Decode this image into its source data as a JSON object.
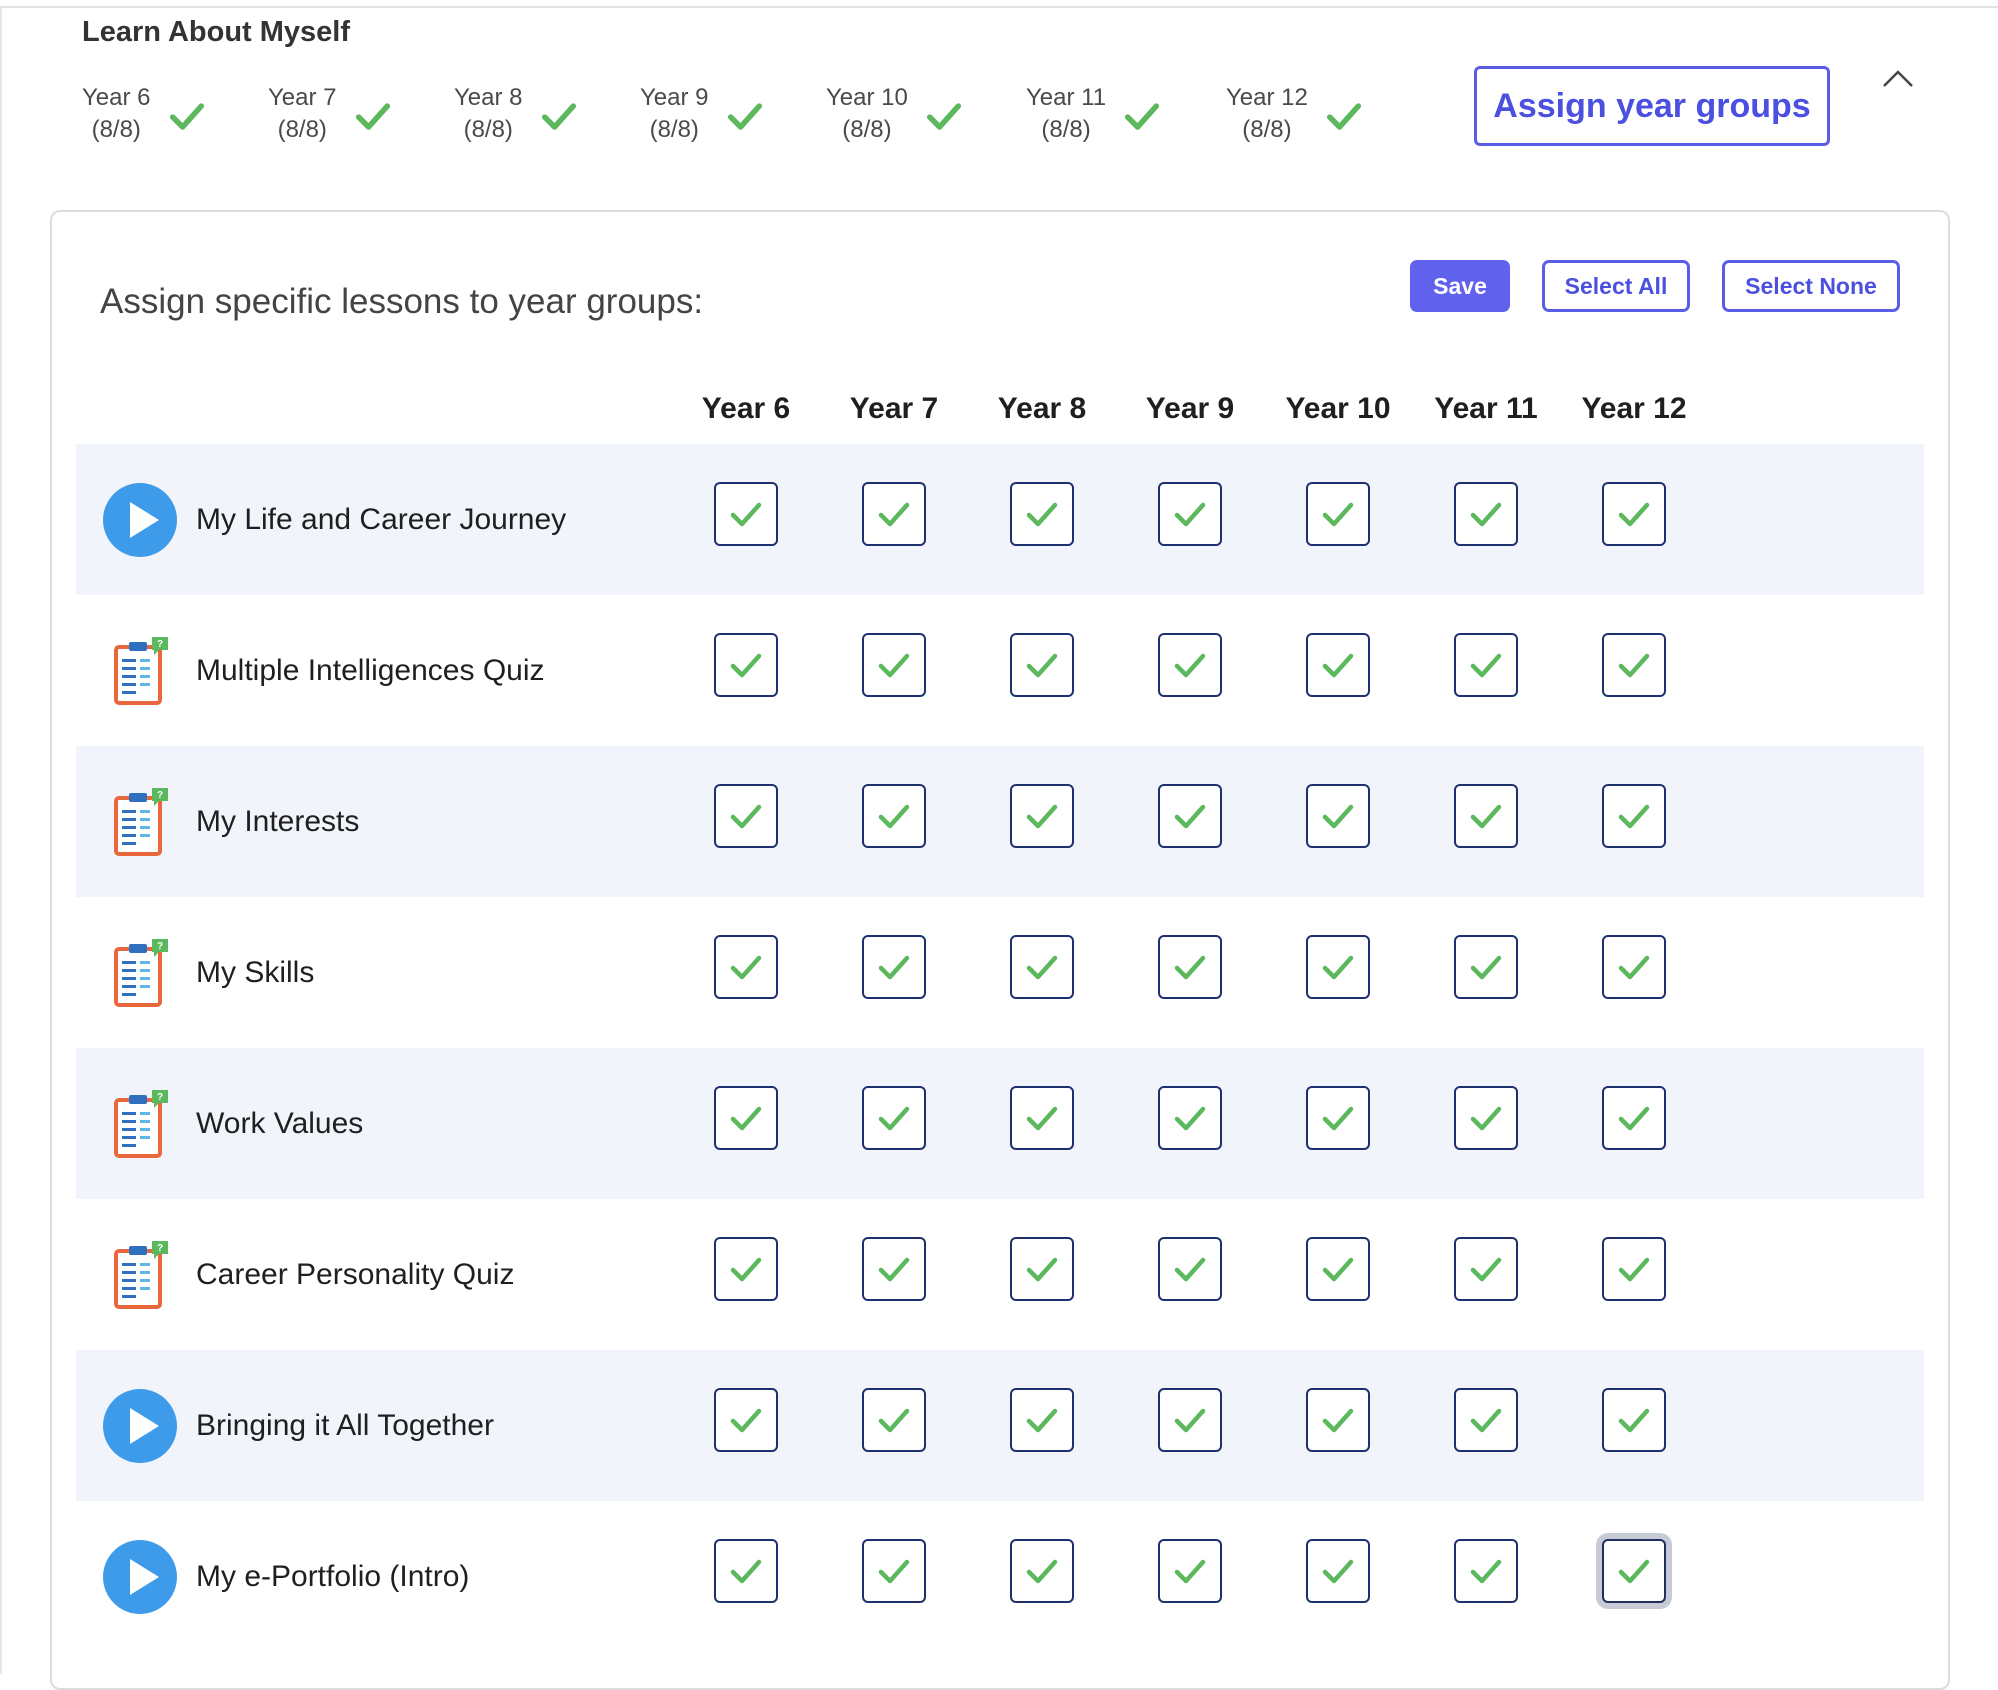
{
  "section": {
    "title": "Learn About Myself",
    "assign_button": "Assign year groups",
    "summary": [
      {
        "year": "Year 6",
        "count": "(8/8)"
      },
      {
        "year": "Year 7",
        "count": "(8/8)"
      },
      {
        "year": "Year 8",
        "count": "(8/8)"
      },
      {
        "year": "Year 9",
        "count": "(8/8)"
      },
      {
        "year": "Year 10",
        "count": "(8/8)"
      },
      {
        "year": "Year 11",
        "count": "(8/8)"
      },
      {
        "year": "Year 12",
        "count": "(8/8)"
      }
    ]
  },
  "panel": {
    "title": "Assign specific lessons to year groups:",
    "save_label": "Save",
    "select_all_label": "Select All",
    "select_none_label": "Select None",
    "columns": [
      "Year 6",
      "Year 7",
      "Year 8",
      "Year 9",
      "Year 10",
      "Year 11",
      "Year 12"
    ],
    "lessons": [
      {
        "name": "My Life and Career Journey",
        "icon": "play-icon",
        "checked": [
          true,
          true,
          true,
          true,
          true,
          true,
          true
        ]
      },
      {
        "name": "Multiple Intelligences Quiz",
        "icon": "clipboard-quiz-icon",
        "checked": [
          true,
          true,
          true,
          true,
          true,
          true,
          true
        ]
      },
      {
        "name": "My Interests",
        "icon": "clipboard-quiz-icon",
        "checked": [
          true,
          true,
          true,
          true,
          true,
          true,
          true
        ]
      },
      {
        "name": "My Skills",
        "icon": "clipboard-quiz-icon",
        "checked": [
          true,
          true,
          true,
          true,
          true,
          true,
          true
        ]
      },
      {
        "name": "Work Values",
        "icon": "clipboard-quiz-icon",
        "checked": [
          true,
          true,
          true,
          true,
          true,
          true,
          true
        ]
      },
      {
        "name": "Career Personality Quiz",
        "icon": "clipboard-quiz-icon",
        "checked": [
          true,
          true,
          true,
          true,
          true,
          true,
          true
        ]
      },
      {
        "name": "Bringing it All Together",
        "icon": "play-icon",
        "checked": [
          true,
          true,
          true,
          true,
          true,
          true,
          true
        ]
      },
      {
        "name": "My e-Portfolio (Intro)",
        "icon": "play-icon",
        "checked": [
          true,
          true,
          true,
          true,
          true,
          true,
          true
        ]
      }
    ]
  },
  "colors": {
    "accent": "#5a5ee6",
    "check_green": "#5cb85c",
    "checkbox_border": "#1f3070",
    "row_shade": "#f1f4fb",
    "play_blue": "#3d9be9",
    "clipboard_orange": "#e8673c"
  }
}
